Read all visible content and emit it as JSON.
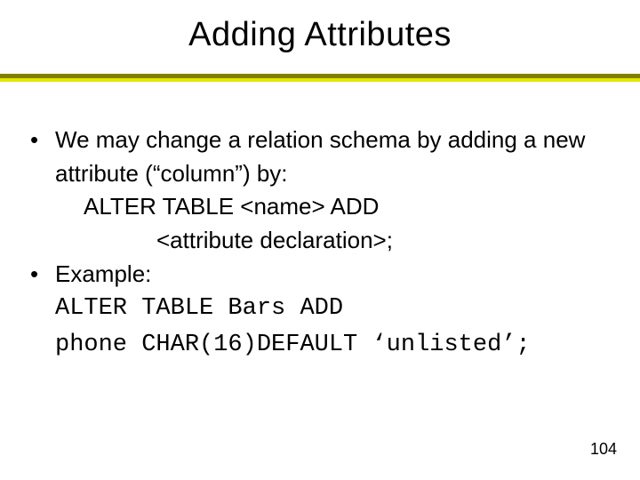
{
  "title": "Adding Attributes",
  "bullets": [
    {
      "text": "We may change a relation schema by adding a new attribute (“column”) by:",
      "sub": [
        "ALTER TABLE <name> ADD",
        "<attribute declaration>;"
      ]
    },
    {
      "text": "Example:",
      "code": [
        "ALTER TABLE Bars ADD",
        "phone CHAR(16)DEFAULT ‘unlisted’;"
      ]
    }
  ],
  "page_number": "104",
  "bullet_glyph": "•"
}
